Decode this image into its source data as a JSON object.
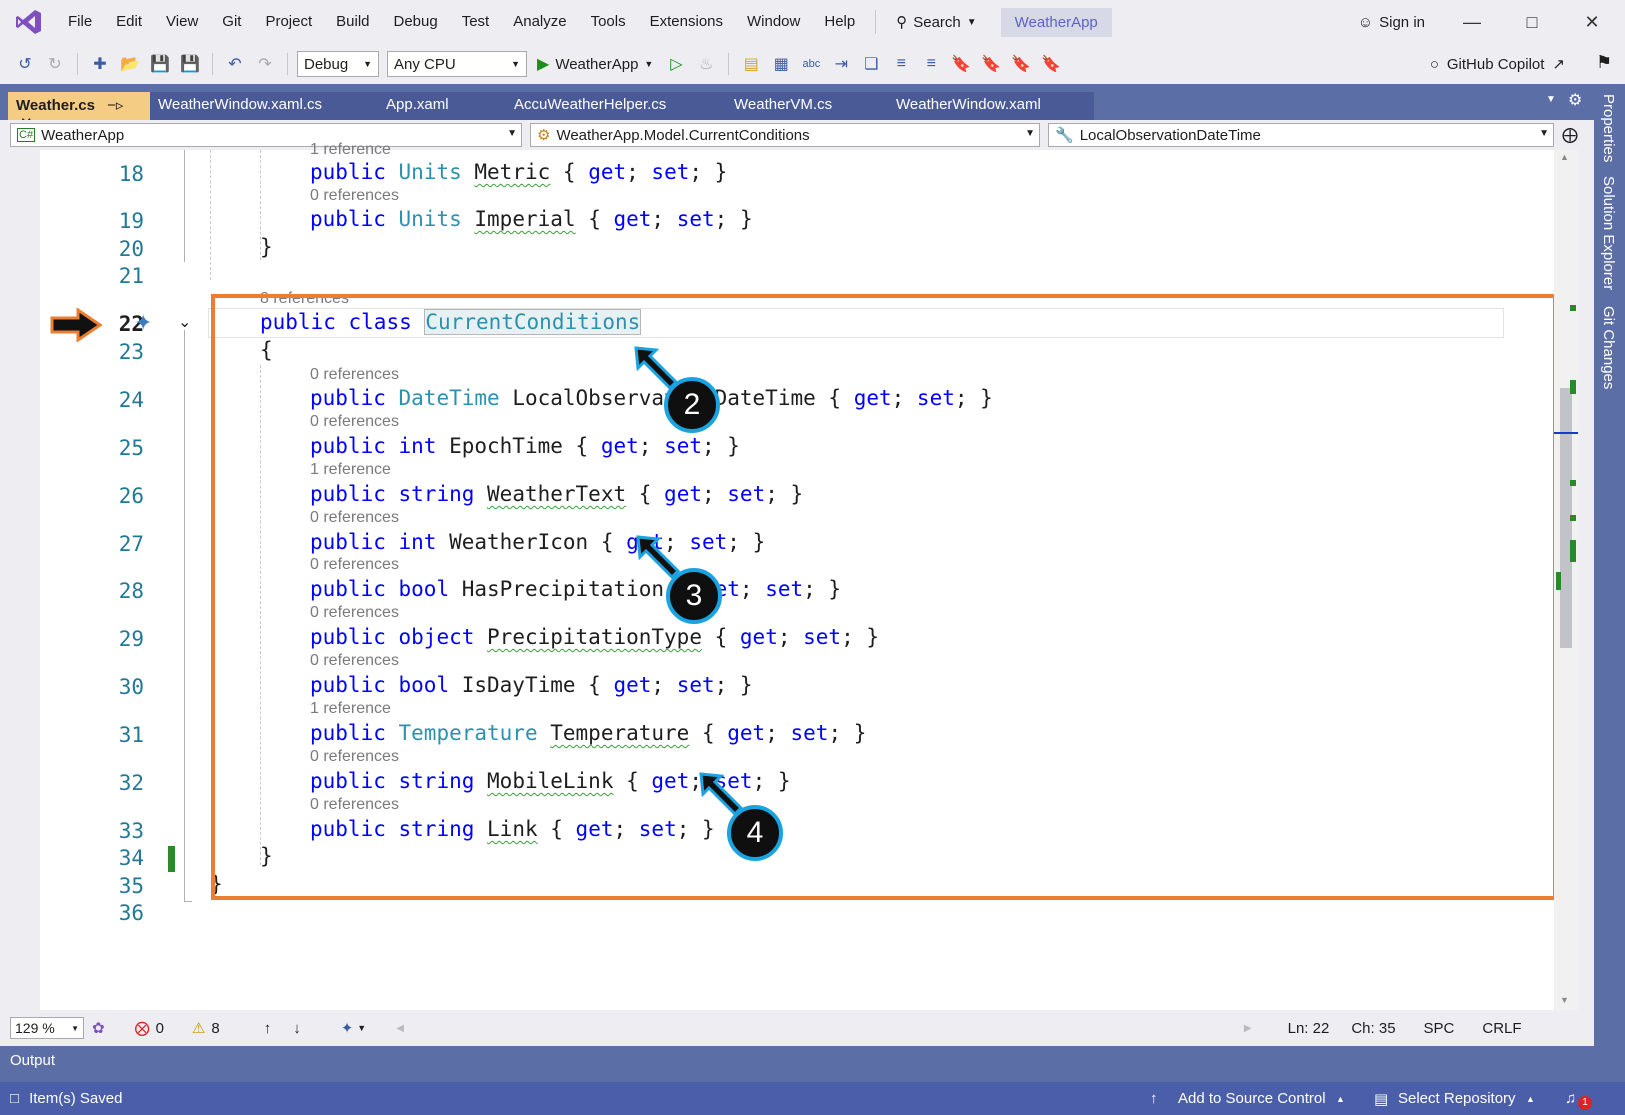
{
  "menu": [
    "File",
    "Edit",
    "View",
    "Git",
    "Project",
    "Build",
    "Debug",
    "Test",
    "Analyze",
    "Tools",
    "Extensions",
    "Window",
    "Help"
  ],
  "search_label": "Search",
  "solution_name": "WeatherApp",
  "sign_in": "Sign in",
  "toolbar": {
    "config": "Debug",
    "platform": "Any CPU",
    "run_target": "WeatherApp",
    "copilot": "GitHub Copilot"
  },
  "tabs": [
    {
      "label": "Weather.cs",
      "active": true
    },
    {
      "label": "WeatherWindow.xaml.cs"
    },
    {
      "label": "App.xaml"
    },
    {
      "label": "AccuWeatherHelper.cs"
    },
    {
      "label": "WeatherVM.cs"
    },
    {
      "label": "WeatherWindow.xaml"
    }
  ],
  "nav": {
    "project": "WeatherApp",
    "type": "WeatherApp.Model.CurrentConditions",
    "member": "LocalObservationDateTime"
  },
  "code": {
    "l18_ref": "1 reference",
    "l19_ref": "0 references",
    "l22_ref": "8 references",
    "l24_ref": "0 references",
    "l25_ref": "0 references",
    "l26_ref": "1 reference",
    "l27_ref": "0 references",
    "l28_ref": "0 references",
    "l29_ref": "0 references",
    "l30_ref": "0 references",
    "l31_ref": "1 reference",
    "l32_ref": "0 references",
    "l33_ref": "0 references",
    "class_name": "CurrentConditions"
  },
  "line_numbers": [
    "18",
    "19",
    "20",
    "21",
    "22",
    "23",
    "24",
    "25",
    "26",
    "27",
    "28",
    "29",
    "30",
    "31",
    "32",
    "33",
    "34",
    "35",
    "36"
  ],
  "callouts": [
    "2",
    "3",
    "4"
  ],
  "editor_status": {
    "zoom": "129 %",
    "errors": "0",
    "warnings": "8",
    "ln": "Ln: 22",
    "ch": "Ch: 35",
    "spc": "SPC",
    "crlf": "CRLF"
  },
  "output_label": "Output",
  "status": {
    "left": "Item(s) Saved",
    "source_control": "Add to Source Control",
    "repo": "Select Repository",
    "notifications": "1"
  },
  "side_panels": [
    "Properties",
    "Solution Explorer",
    "Git Changes"
  ],
  "colors": {
    "accent": "#5c6ea6",
    "highlight_box": "#ed7d31",
    "callout_ring": "#1aa3e0",
    "keyword": "#0000ff",
    "type": "#2b91af"
  }
}
